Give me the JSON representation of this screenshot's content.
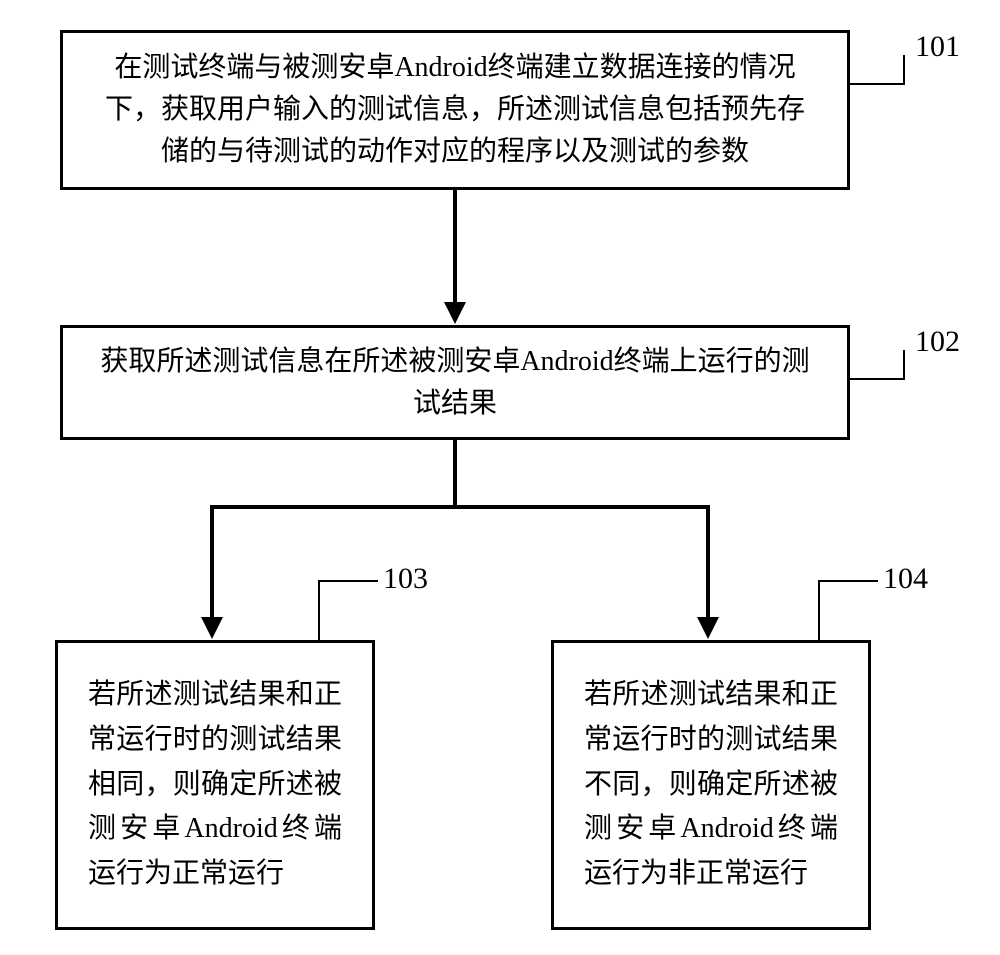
{
  "boxes": {
    "b101": "在测试终端与被测安卓Android终端建立数据连接的情况下，获取用户输入的测试信息，所述测试信息包括预先存储的与待测试的动作对应的程序以及测试的参数",
    "b102": "获取所述测试信息在所述被测安卓Android终端上运行的测试结果",
    "b103": "若所述测试结果和正常运行时的测试结果相同，则确定所述被测安卓Android终端运行为正常运行",
    "b104": "若所述测试结果和正常运行时的测试结果不同，则确定所述被测安卓Android终端运行为非正常运行"
  },
  "labels": {
    "l101": "101",
    "l102": "102",
    "l103": "103",
    "l104": "104"
  }
}
